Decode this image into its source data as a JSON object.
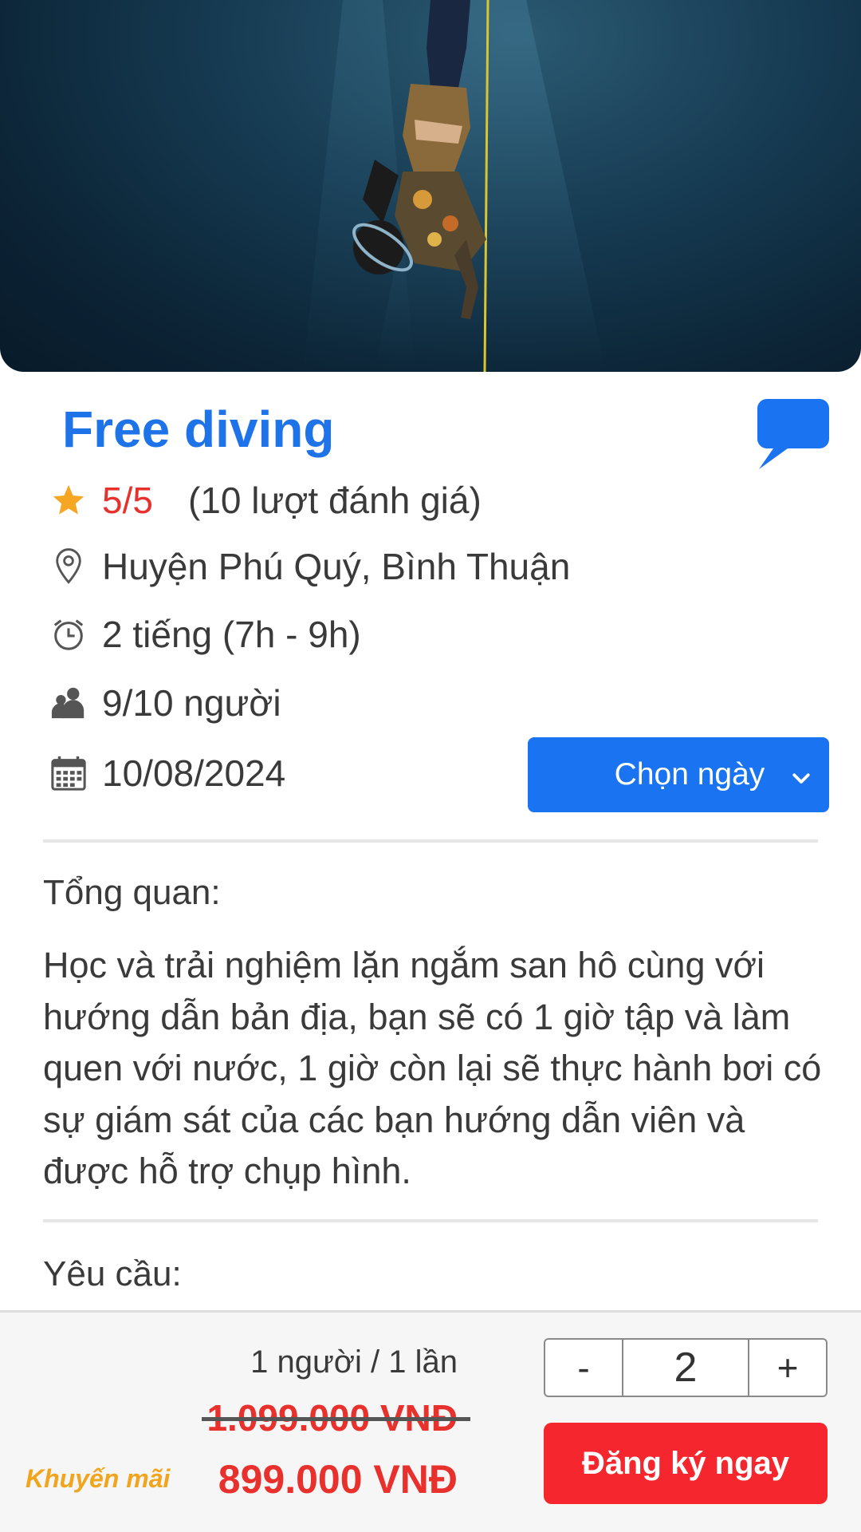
{
  "activity": {
    "title": "Free diving",
    "rating_value": "5/5",
    "rating_count": "(10 lượt đánh giá)",
    "location": "Huyện Phú Quý, Bình Thuận",
    "duration": "2 tiếng (7h - 9h)",
    "capacity": "9/10 người",
    "date": "10/08/2024",
    "date_button_label": "Chọn ngày"
  },
  "overview": {
    "heading": "Tổng quan:",
    "text": "Học và trải nghiệm lặn ngắm san hô cùng với hướng dẫn bản địa, bạn sẽ có 1 giờ tập và làm quen với nước, 1 giờ còn lại sẽ thực hành bơi có sự giám sát của các bạn hướng dẫn viên và được hỗ trợ chụp hình."
  },
  "requirements": {
    "heading": "Yêu cầu:"
  },
  "booking": {
    "per_unit": "1 người / 1 lần",
    "old_price": "1.099.000 VNĐ",
    "promo_label": "Khuyến mãi",
    "new_price": "899.000 VNĐ",
    "decrement_label": "-",
    "quantity": "2",
    "increment_label": "+",
    "register_label": "Đăng ký ngay"
  },
  "icons": {
    "rating": "star-icon",
    "location": "map-pin-icon",
    "duration": "alarm-clock-icon",
    "capacity": "people-icon",
    "date": "calendar-icon",
    "chat": "chat-bubble-icon",
    "dropdown": "chevron-down-icon"
  },
  "colors": {
    "primary_blue": "#1f73e8",
    "button_blue": "#1a73f0",
    "price_red": "#e8312c",
    "register_red": "#f5262d",
    "promo_orange": "#f0a51c",
    "star_gold": "#f5a623"
  }
}
